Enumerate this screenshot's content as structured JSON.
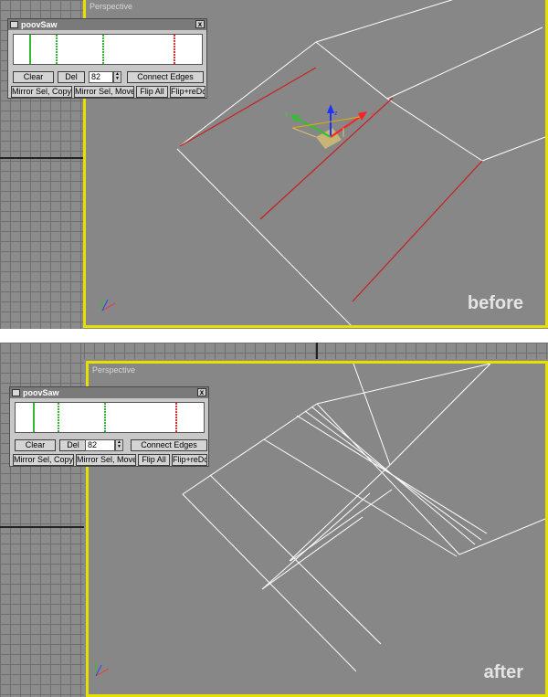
{
  "before": {
    "viewport_label": "Perspective",
    "caption": "before"
  },
  "after": {
    "viewport_label": "Perspective",
    "caption": "after"
  },
  "rollout": {
    "title": "poovSaw",
    "close": "x",
    "clear": "Clear",
    "del": "Del",
    "spinner_value": "82",
    "connect_edges": "Connect Edges",
    "mirror_copy": "Mirror Sel, Copy",
    "mirror_move": "Mirror Sel, Move",
    "flip_all": "Flip All",
    "flip_redo": "Flip+reDo"
  },
  "gizmo": {
    "x": "x",
    "y": "y",
    "z": "z"
  },
  "colors": {
    "viewport_border": "#e6e000",
    "selected_edge": "#c82020",
    "edge": "#ffffff"
  }
}
